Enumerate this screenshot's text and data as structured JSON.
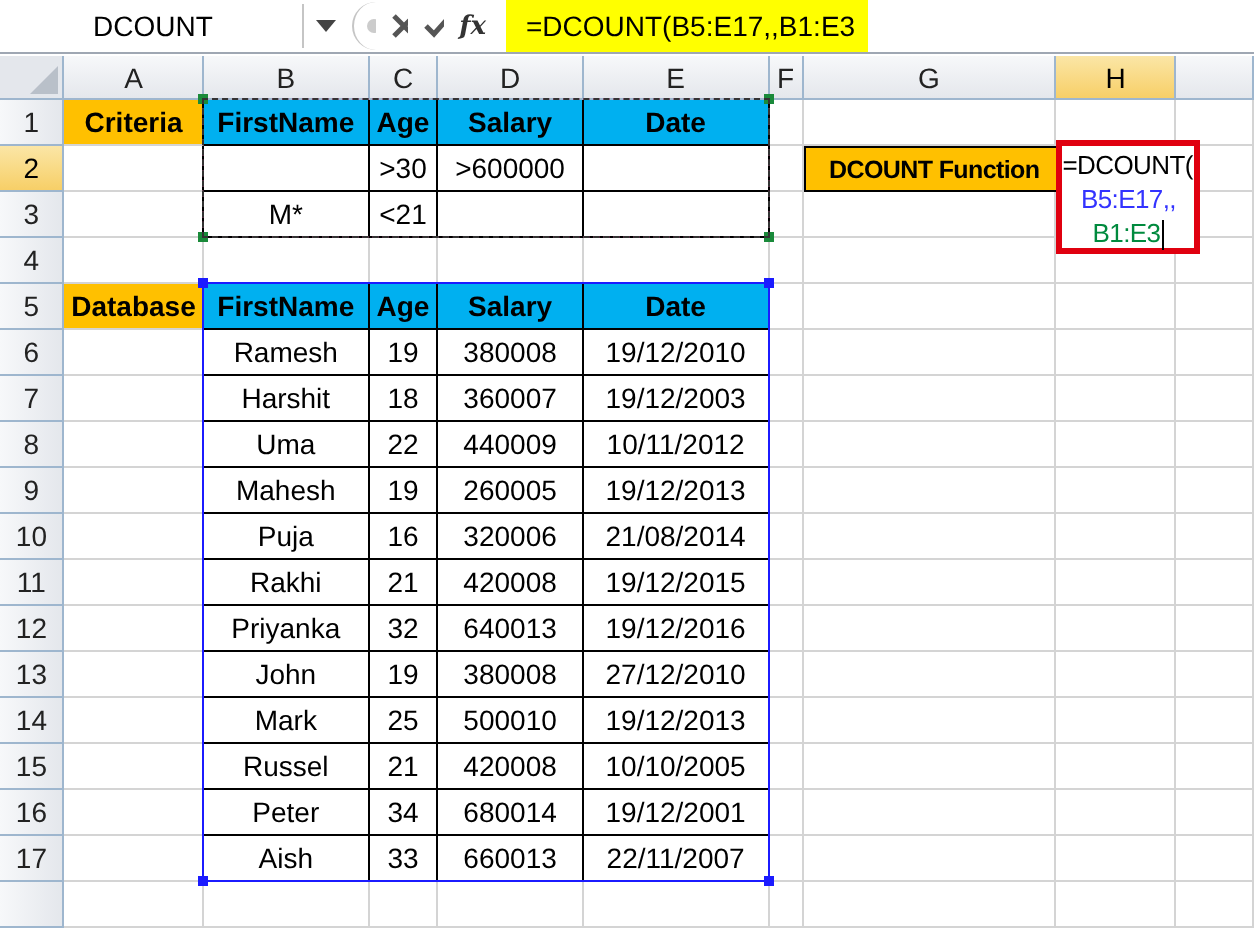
{
  "name_box": {
    "value": "DCOUNT"
  },
  "formula_bar": {
    "function_button": "fx",
    "value": "=DCOUNT(B5:E17,,B1:E3",
    "highlighted": true
  },
  "columns": [
    {
      "label": "A",
      "selected": false
    },
    {
      "label": "B",
      "selected": false
    },
    {
      "label": "C",
      "selected": false
    },
    {
      "label": "D",
      "selected": false
    },
    {
      "label": "E",
      "selected": false
    },
    {
      "label": "F",
      "selected": false
    },
    {
      "label": "G",
      "selected": false
    },
    {
      "label": "H",
      "selected": true
    }
  ],
  "row_headers": [
    {
      "label": "1",
      "selected": false
    },
    {
      "label": "2",
      "selected": true
    },
    {
      "label": "3",
      "selected": false
    },
    {
      "label": "4",
      "selected": false
    },
    {
      "label": "5",
      "selected": false
    },
    {
      "label": "6",
      "selected": false
    },
    {
      "label": "7",
      "selected": false
    },
    {
      "label": "8",
      "selected": false
    },
    {
      "label": "9",
      "selected": false
    },
    {
      "label": "10",
      "selected": false
    },
    {
      "label": "11",
      "selected": false
    },
    {
      "label": "12",
      "selected": false
    },
    {
      "label": "13",
      "selected": false
    },
    {
      "label": "14",
      "selected": false
    },
    {
      "label": "15",
      "selected": false
    },
    {
      "label": "16",
      "selected": false
    },
    {
      "label": "17",
      "selected": false
    }
  ],
  "criteria": {
    "label": "Criteria",
    "headers": [
      "FirstName",
      "Age",
      "Salary",
      "Date"
    ],
    "rows": [
      [
        null,
        ">30",
        ">600000",
        null
      ],
      [
        "M*",
        "<21",
        null,
        null
      ]
    ]
  },
  "database": {
    "label": "Database",
    "headers": [
      "FirstName",
      "Age",
      "Salary",
      "Date"
    ],
    "rows": [
      [
        "Ramesh",
        "19",
        "380008",
        "19/12/2010"
      ],
      [
        "Harshit",
        "18",
        "360007",
        "19/12/2003"
      ],
      [
        "Uma",
        "22",
        "440009",
        "10/11/2012"
      ],
      [
        "Mahesh",
        "19",
        "260005",
        "19/12/2013"
      ],
      [
        "Puja",
        "16",
        "320006",
        "21/08/2014"
      ],
      [
        "Rakhi",
        "21",
        "420008",
        "19/12/2015"
      ],
      [
        "Priyanka",
        "32",
        "640013",
        "19/12/2016"
      ],
      [
        "John",
        "19",
        "380008",
        "27/12/2010"
      ],
      [
        "Mark",
        "25",
        "500010",
        "19/12/2013"
      ],
      [
        "Russel",
        "21",
        "420008",
        "10/10/2005"
      ],
      [
        "Peter",
        "34",
        "680014",
        "19/12/2001"
      ],
      [
        "Aish",
        "33",
        "660013",
        "22/11/2007"
      ]
    ]
  },
  "function_label": "DCOUNT Function",
  "formula_cell": {
    "parts": [
      {
        "text": "=DCOUNT(",
        "color": "#000000"
      },
      {
        "text": "B5:E17,,",
        "color": "#3333ff"
      },
      {
        "text": "B1:E3",
        "color": "#008a3e"
      }
    ]
  }
}
